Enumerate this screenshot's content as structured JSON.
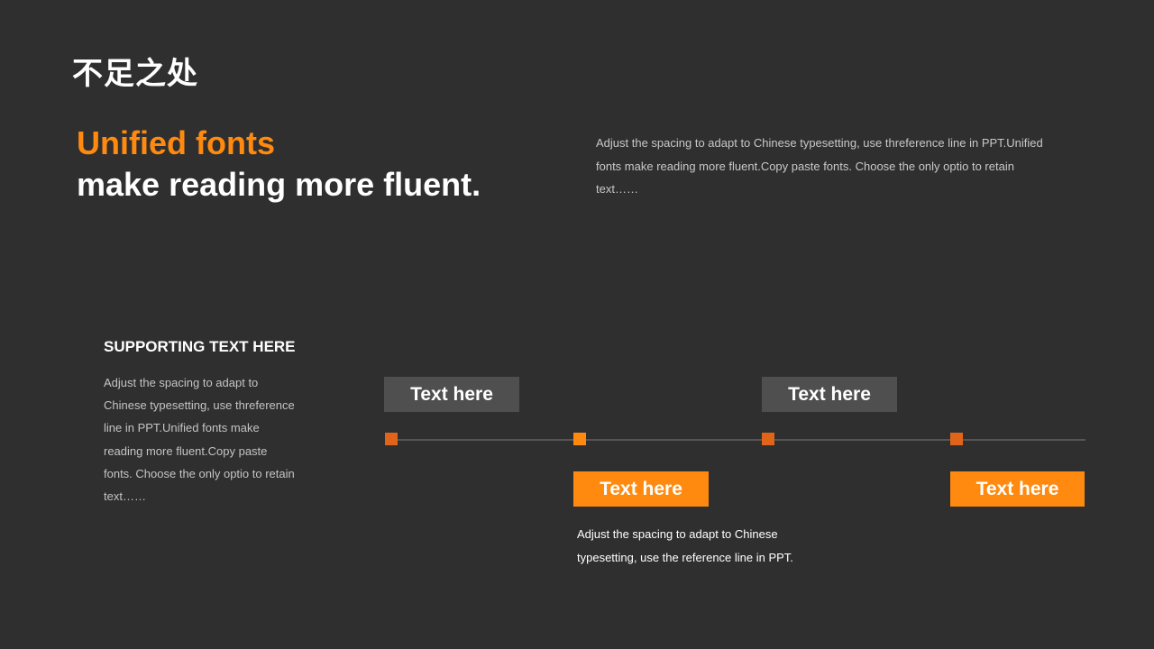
{
  "slide": {
    "title": "不足之处",
    "headline_accent": "Unified fonts",
    "headline_main": "make reading more fluent.",
    "intro_text": "Adjust the spacing to adapt to Chinese typesetting, use threference line in PPT.Unified fonts make reading more fluent.Copy paste fonts. Choose the only optio to retain text……"
  },
  "supporting": {
    "title": "SUPPORTING TEXT HERE",
    "body": "Adjust the spacing to adapt to Chinese typesetting, use threference line in PPT.Unified fonts make reading more fluent.Copy paste fonts. Choose the only optio to retain text……"
  },
  "timeline": {
    "labels": [
      "Text here",
      "Text here",
      "Text here",
      "Text here"
    ],
    "caption": "Adjust the spacing to adapt to Chinese typesetting, use the reference line in PPT."
  },
  "colors": {
    "background": "#2f2f2f",
    "accent": "#ff8a0f",
    "marker_dark": "#e2641a",
    "gray_box": "#4f4f4f"
  }
}
